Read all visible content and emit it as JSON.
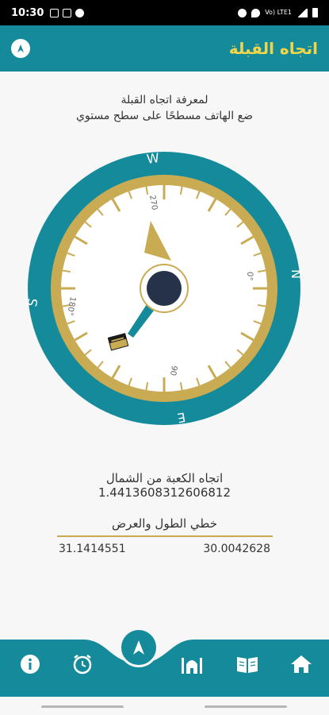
{
  "status_bar": {
    "time": "10:30",
    "network_label": "Vo) LTE1",
    "icons": [
      "image-icon",
      "mail-icon",
      "whatsapp-icon",
      "alarm-icon",
      "location-icon",
      "signal-icon",
      "battery-icon"
    ]
  },
  "header": {
    "title": "اتجاه القبلة",
    "menu_icon": "navigation-arrow-icon"
  },
  "instructions": {
    "line1": "لمعرفة اتجاه القبلة",
    "line2": "ضع الهاتف مسطحًا على سطح مستوي"
  },
  "compass": {
    "cardinals": {
      "north": "N",
      "east": "E",
      "south": "S",
      "west": "W"
    },
    "degree_labels": {
      "north": "0°",
      "east": "90",
      "south": "180°",
      "west": "270"
    },
    "heading_degrees": 270,
    "qibla_degrees": 1.4413608312606812,
    "colors": {
      "outer_ring": "#148a9a",
      "gold_ring": "#c9ab54",
      "center": "#26314a",
      "qibla_needle": "#148a9a",
      "north_needle": "#c9ab54"
    }
  },
  "kaaba": {
    "label": "اتجاه الكعبة من الشمال",
    "value": "1.4413608312606812"
  },
  "coordinates": {
    "title": "خطي الطول والعرض",
    "left_value": "31.1414551",
    "right_value": "30.0042628"
  },
  "bottom_nav": {
    "items": [
      "info-icon",
      "alarm-clock-icon",
      "compass-arrow-icon",
      "mosque-icon",
      "quran-book-icon",
      "home-icon"
    ]
  },
  "colors": {
    "brand": "#148a9a",
    "accent": "#f2d548",
    "gold": "#c9ab54"
  }
}
